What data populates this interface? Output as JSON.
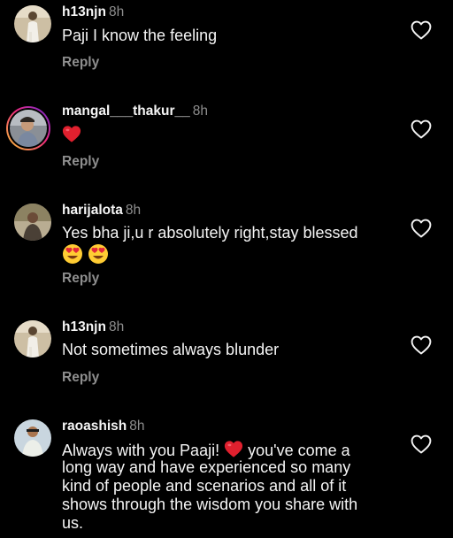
{
  "comments": [
    {
      "username": "h13njn",
      "time": "8h",
      "text": "Paji I know the feeling",
      "reply_label": "Reply"
    },
    {
      "username": "mangal___thakur__",
      "time": "8h",
      "text": "",
      "reply_label": "Reply"
    },
    {
      "username": "harijalota",
      "time": "8h",
      "text": "Yes bha ji,u r absolutely right,stay blessed",
      "reply_label": "Reply"
    },
    {
      "username": "h13njn",
      "time": "8h",
      "text": "Not sometimes always blunder",
      "reply_label": "Reply"
    },
    {
      "username": "raoashish",
      "time": "8h",
      "text_line1_a": "Always with you Paaji!",
      "text_line1_b": "you've come a",
      "text_line2": "long way and have experienced so many",
      "text_line3": "kind of people and scenarios and all of it",
      "text_line4": "shows through the wisdom you share with",
      "text_line5": "us."
    }
  ],
  "colors": {
    "background": "#000000",
    "primary_text": "#f5f5f5",
    "secondary_text": "#8e8e8e",
    "heart_red": "#ff3040"
  },
  "icons": {
    "like": "heart-outline-icon",
    "emoji_heart": "red-heart-emoji",
    "emoji_heart_eyes": "heart-eyes-emoji"
  }
}
